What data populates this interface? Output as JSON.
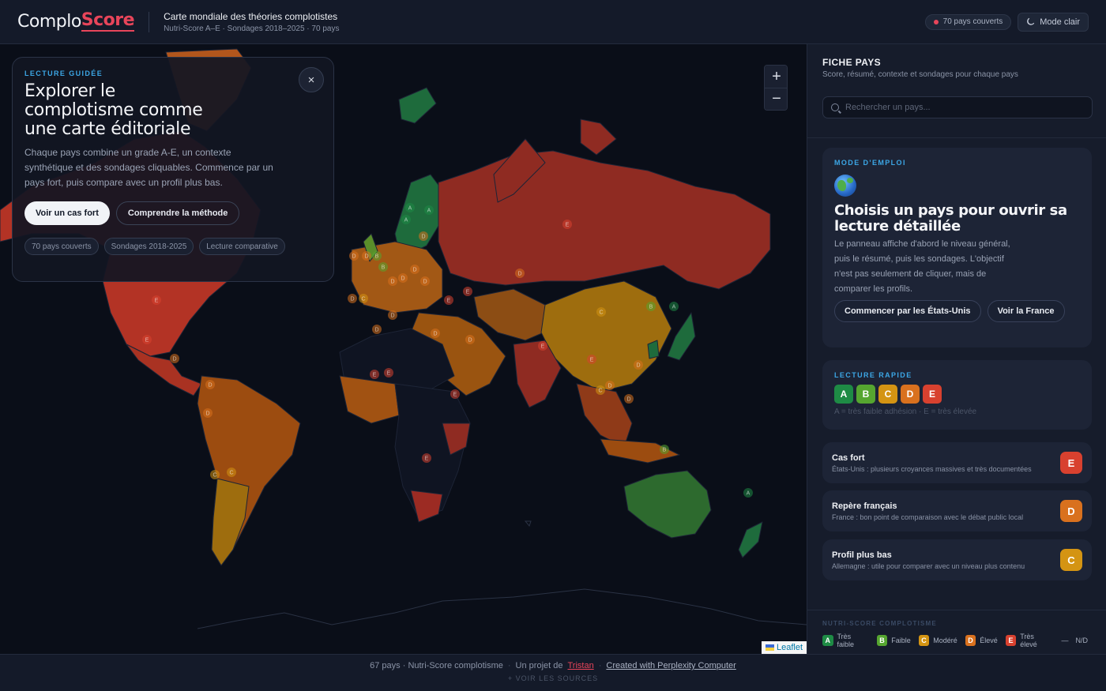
{
  "header": {
    "logo_main": "Complo",
    "logo_accent": "Score",
    "title": "Carte mondiale des théories complotistes",
    "subtitle": "Nutri-Score A–E · Sondages 2018–2025 · 70 pays",
    "countries_pill": "70 pays couverts",
    "mode_button": "Mode clair"
  },
  "map": {
    "zoom_in": "+",
    "zoom_out": "−",
    "attribution": "Leaflet",
    "markers": [
      {
        "g": "E"
      },
      {
        "g": "E"
      },
      {
        "g": "D"
      },
      {
        "g": "D"
      },
      {
        "g": "D"
      },
      {
        "g": "C"
      },
      {
        "g": "C"
      },
      {
        "g": "E"
      },
      {
        "g": "A"
      },
      {
        "g": "A"
      },
      {
        "g": "A"
      },
      {
        "g": "D"
      },
      {
        "g": "D"
      },
      {
        "g": "B"
      },
      {
        "g": "B"
      },
      {
        "g": "D"
      },
      {
        "g": "D"
      },
      {
        "g": "D"
      },
      {
        "g": "C"
      },
      {
        "g": "E"
      },
      {
        "g": "E"
      },
      {
        "g": "D"
      },
      {
        "g": "D"
      },
      {
        "g": "D"
      },
      {
        "g": "D"
      },
      {
        "g": "E"
      },
      {
        "g": "E"
      },
      {
        "g": "D"
      },
      {
        "g": "C"
      },
      {
        "g": "B"
      },
      {
        "g": "A"
      },
      {
        "g": "E"
      },
      {
        "g": "D"
      },
      {
        "g": "D"
      },
      {
        "g": "C"
      },
      {
        "g": "D"
      },
      {
        "g": "E"
      },
      {
        "g": "E"
      },
      {
        "g": "B"
      },
      {
        "g": "A"
      },
      {
        "g": "D"
      },
      {
        "g": "E"
      },
      {
        "g": "D"
      },
      {
        "g": "D"
      }
    ]
  },
  "guide": {
    "eyebrow": "LECTURE GUIDÉE",
    "title": "Explorer le complotisme comme une carte éditoriale",
    "body": "Chaque pays combine un grade A-E, un contexte synthétique et des sondages cliquables. Commence par un pays fort, puis compare avec un profil plus bas.",
    "close": "×",
    "btn_primary": "Voir un cas fort",
    "btn_secondary": "Comprendre la méthode",
    "tags": [
      "70 pays couverts",
      "Sondages 2018-2025",
      "Lecture comparative"
    ]
  },
  "panel": {
    "title": "FICHE PAYS",
    "subtitle": "Score, résumé, contexte et sondages pour chaque pays",
    "search_placeholder": "Rechercher un pays...",
    "howto": {
      "eyebrow": "MODE D'EMPLOI",
      "title": "Choisis un pays pour ouvrir sa lecture détaillée",
      "body": "Le panneau affiche d'abord le niveau général, puis le résumé, puis les sondages. L'objectif n'est pas seulement de cliquer, mais de comparer les profils.",
      "btn1": "Commencer par les États-Unis",
      "btn2": "Voir la France"
    },
    "quick": {
      "eyebrow": "LECTURE RAPIDE",
      "grades": [
        "A",
        "B",
        "C",
        "D",
        "E"
      ],
      "hint": "A = très faible adhésion · E = très élevée"
    },
    "cases": [
      {
        "name": "Cas fort",
        "desc": "États-Unis : plusieurs croyances massives et très documentées",
        "grade": "E"
      },
      {
        "name": "Repère français",
        "desc": "France : bon point de comparaison avec le débat public local",
        "grade": "D"
      },
      {
        "name": "Profil plus bas",
        "desc": "Allemagne : utile pour comparer avec un niveau plus contenu",
        "grade": "C"
      }
    ],
    "legend": {
      "title": "NUTRI-SCORE COMPLOTISME",
      "items": [
        {
          "g": "A",
          "label": "Très faible"
        },
        {
          "g": "B",
          "label": "Faible"
        },
        {
          "g": "C",
          "label": "Modéré"
        },
        {
          "g": "D",
          "label": "Élevé"
        },
        {
          "g": "E",
          "label": "Très élevé"
        }
      ],
      "na_symbol": "—",
      "na_label": "N/D"
    }
  },
  "footer": {
    "count": "67 pays · Nutri-Score complotisme",
    "sep": "·",
    "project": "Un projet de",
    "author": "Tristan",
    "created": "Created with Perplexity Computer",
    "sources": "+ VOIR LES SOURCES"
  },
  "colors": {
    "A": "#1e8b45",
    "B": "#56a630",
    "C": "#d49413",
    "D": "#d9711e",
    "E": "#d8412f",
    "accent": "#e8455a",
    "link_blue": "#3ca7e6"
  }
}
